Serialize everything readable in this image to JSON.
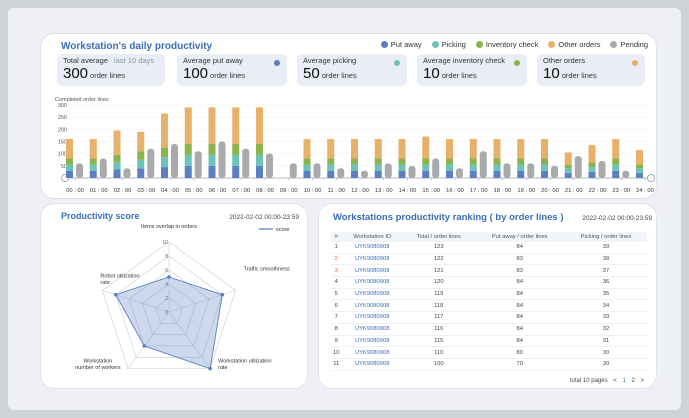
{
  "daily": {
    "title": "Workstation's daily productivity",
    "legend": [
      {
        "label": "Put away",
        "color": "#5b7fc0"
      },
      {
        "label": "Picking",
        "color": "#6cc3b8"
      },
      {
        "label": "Inventory check",
        "color": "#8ab34c"
      },
      {
        "label": "Other orders",
        "color": "#e7b16a"
      },
      {
        "label": "Pending",
        "color": "#a9aaab"
      }
    ],
    "stats": [
      {
        "label": "Total average",
        "sub": "last 10 days",
        "value": "300",
        "unit": "order lines",
        "color": ""
      },
      {
        "label": "Average put away",
        "sub": "",
        "value": "100",
        "unit": "order lines",
        "color": "#5b7fc0"
      },
      {
        "label": "Average picking",
        "sub": "",
        "value": "50",
        "unit": "order lines",
        "color": "#6cc3b8"
      },
      {
        "label": "Average inventory check",
        "sub": "",
        "value": "10",
        "unit": "order lines",
        "color": "#8ab34c"
      },
      {
        "label": "Other orders",
        "sub": "",
        "value": "10",
        "unit": "order lines",
        "color": "#e7b16a"
      }
    ]
  },
  "chart_data": [
    {
      "type": "bar",
      "ylabel": "Completed order lines",
      "ylim": [
        0,
        300
      ],
      "yticks": [
        50,
        100,
        150,
        200,
        250,
        300
      ],
      "categories": [
        "00 : 00",
        "01 : 00",
        "02 : 00",
        "03 : 00",
        "04 : 00",
        "05 : 00",
        "06 : 00",
        "07 : 00",
        "08 : 00",
        "09 : 00",
        "10 : 00",
        "11 : 00",
        "12 : 00",
        "13 : 00",
        "14 : 00",
        "15 : 00",
        "16 : 00",
        "17 : 00",
        "18 : 00",
        "19 : 00",
        "20 : 00",
        "21 : 00",
        "22 : 00",
        "23 : 00",
        "24 : 00"
      ],
      "series": [
        {
          "name": "Put away",
          "color": "#5b7fc0",
          "values": [
            30,
            30,
            35,
            40,
            45,
            50,
            50,
            50,
            50,
            0,
            30,
            30,
            30,
            30,
            30,
            30,
            30,
            30,
            30,
            30,
            30,
            20,
            25,
            30,
            20
          ]
        },
        {
          "name": "Picking",
          "color": "#6cc3b8",
          "values": [
            25,
            25,
            30,
            35,
            40,
            45,
            45,
            45,
            45,
            0,
            25,
            25,
            25,
            25,
            25,
            25,
            25,
            25,
            25,
            25,
            25,
            20,
            20,
            25,
            20
          ]
        },
        {
          "name": "Inventory check",
          "color": "#8ab34c",
          "values": [
            25,
            25,
            30,
            35,
            40,
            45,
            45,
            45,
            45,
            0,
            25,
            25,
            25,
            25,
            25,
            25,
            25,
            25,
            25,
            25,
            25,
            15,
            20,
            25,
            15
          ]
        },
        {
          "name": "Other orders",
          "color": "#e7b16a",
          "values": [
            80,
            80,
            100,
            80,
            140,
            150,
            150,
            150,
            150,
            0,
            80,
            80,
            80,
            80,
            80,
            90,
            80,
            80,
            80,
            80,
            80,
            50,
            70,
            80,
            60
          ]
        },
        {
          "name": "Pending",
          "color": "#a9aaab",
          "values": [
            60,
            80,
            40,
            120,
            140,
            110,
            150,
            120,
            100,
            60,
            60,
            40,
            30,
            60,
            50,
            80,
            40,
            110,
            60,
            60,
            50,
            90,
            70,
            30,
            0
          ]
        }
      ]
    },
    {
      "type": "radar",
      "title": "Productivity score",
      "legend": "score",
      "axes": [
        "Items overlap in orders",
        "Traffic smoothness",
        "Workstation utilization rate",
        "Workstation number of workers",
        "Robot utilization rate"
      ],
      "ticks": [
        0,
        2,
        4,
        6,
        8,
        10
      ],
      "rmax": 10,
      "values": [
        5,
        8,
        10,
        6,
        8
      ],
      "color": "#5b7fc0"
    }
  ],
  "score": {
    "title": "Productivity score",
    "date": "2022-02-02  00:00-23:59"
  },
  "ranking": {
    "title": "Workstations productivity ranking ( by order lines )",
    "date": "2022-02-02  00:00-23:59",
    "columns": [
      "#",
      "Workstation ID",
      "Total / order lines",
      "Put away / order lines",
      "Picking / order lines"
    ],
    "rows": [
      [
        "1",
        "UYK9080908",
        "123",
        "84",
        "39"
      ],
      [
        "2",
        "UYK9080908",
        "122",
        "83",
        "38"
      ],
      [
        "3",
        "UYK9080908",
        "121",
        "83",
        "37"
      ],
      [
        "4",
        "UYK9080908",
        "120",
        "84",
        "36"
      ],
      [
        "5",
        "UYK9080908",
        "119",
        "84",
        "35"
      ],
      [
        "6",
        "UYK9080908",
        "118",
        "84",
        "34"
      ],
      [
        "7",
        "UYK9080908",
        "117",
        "84",
        "33"
      ],
      [
        "8",
        "UYK9080908",
        "116",
        "84",
        "32"
      ],
      [
        "9",
        "UYK9080908",
        "115",
        "84",
        "31"
      ],
      [
        "10",
        "UYK9080908",
        "110",
        "80",
        "30"
      ],
      [
        "11",
        "UYK9080908",
        "100",
        "70",
        "30"
      ]
    ],
    "pager": {
      "total": "total 10 pages",
      "prev": "<",
      "pages": [
        "1",
        "2"
      ],
      "next": ">"
    }
  }
}
